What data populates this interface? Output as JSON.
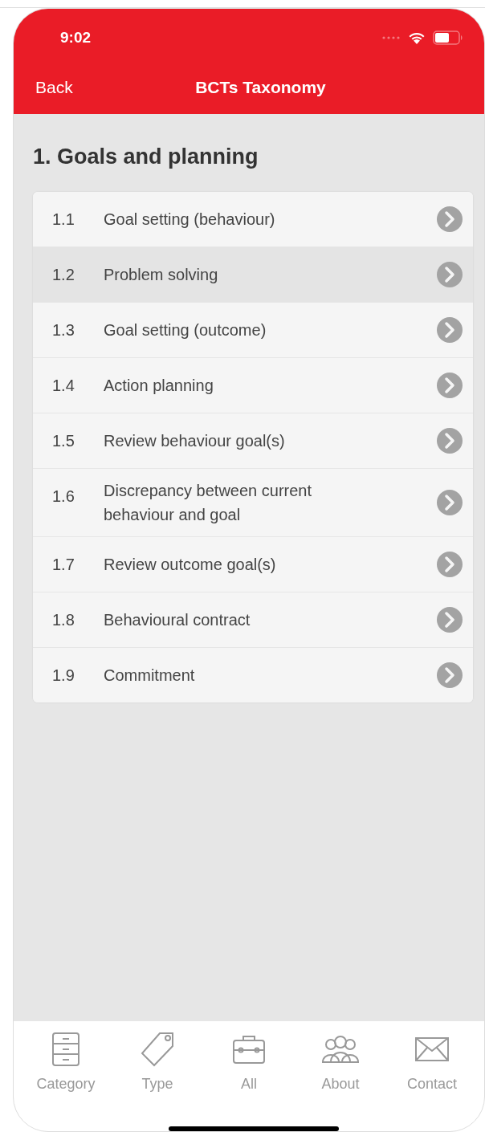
{
  "status_bar": {
    "time": "9:02"
  },
  "nav_bar": {
    "back": "Back",
    "title": "BCTs Taxonomy"
  },
  "section": {
    "title": "1. Goals and planning"
  },
  "items": [
    {
      "number": "1.1",
      "label": "Goal setting (behaviour)",
      "selected": false
    },
    {
      "number": "1.2",
      "label": "Problem solving",
      "selected": true
    },
    {
      "number": "1.3",
      "label": "Goal setting (outcome)",
      "selected": false
    },
    {
      "number": "1.4",
      "label": "Action planning",
      "selected": false
    },
    {
      "number": "1.5",
      "label": "Review behaviour goal(s)",
      "selected": false
    },
    {
      "number": "1.6",
      "label": "Discrepancy between current behaviour and goal",
      "selected": false
    },
    {
      "number": "1.7",
      "label": "Review outcome goal(s)",
      "selected": false
    },
    {
      "number": "1.8",
      "label": "Behavioural contract",
      "selected": false
    },
    {
      "number": "1.9",
      "label": "Commitment",
      "selected": false
    }
  ],
  "tab_bar": [
    {
      "kind": "category",
      "label": "Category"
    },
    {
      "kind": "type",
      "label": "Type"
    },
    {
      "kind": "all",
      "label": "All"
    },
    {
      "kind": "about",
      "label": "About"
    },
    {
      "kind": "contact",
      "label": "Contact"
    }
  ]
}
